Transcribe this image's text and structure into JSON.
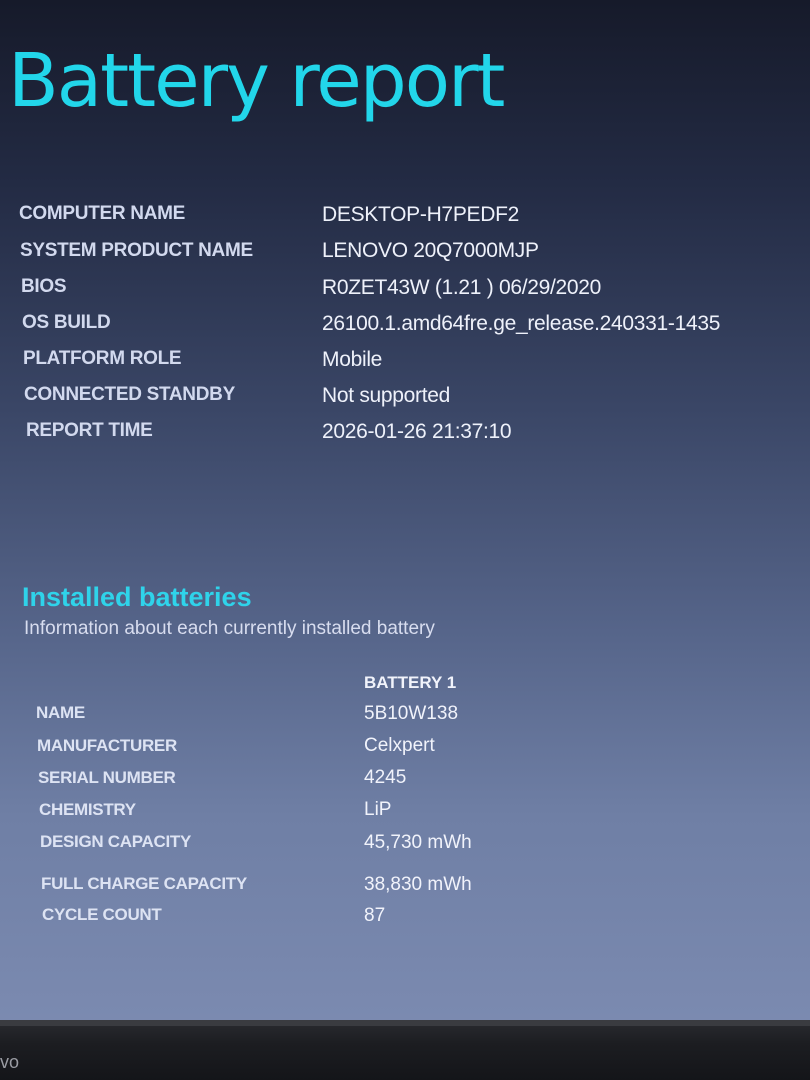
{
  "report": {
    "title": "Battery report",
    "system_info": [
      {
        "label": "COMPUTER NAME",
        "value": "DESKTOP-H7PEDF2"
      },
      {
        "label": "SYSTEM PRODUCT NAME",
        "value": "LENOVO 20Q7000MJP"
      },
      {
        "label": "BIOS",
        "value": "R0ZET43W (1.21 ) 06/29/2020"
      },
      {
        "label": "OS BUILD",
        "value": "26100.1.amd64fre.ge_release.240331-1435"
      },
      {
        "label": "PLATFORM ROLE",
        "value": "Mobile"
      },
      {
        "label": "CONNECTED STANDBY",
        "value": "Not supported"
      },
      {
        "label": "REPORT TIME",
        "value": "2026-01-26  21:37:10"
      }
    ]
  },
  "installed_batteries": {
    "title": "Installed batteries",
    "subtitle": "Information about each currently installed battery",
    "column_header": "BATTERY 1",
    "rows": [
      {
        "label": "NAME",
        "value": "5B10W138"
      },
      {
        "label": "MANUFACTURER",
        "value": "Celxpert"
      },
      {
        "label": "SERIAL NUMBER",
        "value": "4245"
      },
      {
        "label": "CHEMISTRY",
        "value": "LiP"
      },
      {
        "label": "DESIGN CAPACITY",
        "value": "45,730 mWh"
      },
      {
        "label": "FULL CHARGE CAPACITY",
        "value": "38,830 mWh"
      },
      {
        "label": "CYCLE COUNT",
        "value": "87"
      }
    ]
  },
  "bezel": {
    "logo_fragment": "vo"
  },
  "colors": {
    "title_accent": "#22d6ea",
    "section_accent": "#2fd3ea",
    "text": "#eef1fa"
  }
}
